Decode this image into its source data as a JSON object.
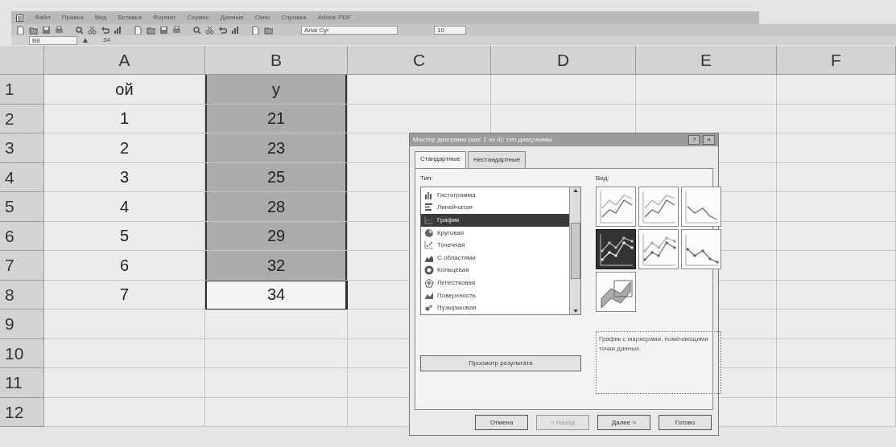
{
  "menu": [
    "Файл",
    "Правка",
    "Вид",
    "Вставка",
    "Формат",
    "Сервис",
    "Данные",
    "Окно",
    "Справка",
    "Adobe PDF"
  ],
  "toolbar": {
    "font": "Arial Cyr",
    "size": "10"
  },
  "formula_bar": {
    "cell": "B8",
    "value": "34"
  },
  "sheet": {
    "columns": [
      "A",
      "B",
      "C",
      "D",
      "E",
      "F"
    ],
    "rows": [
      {
        "number": "1",
        "cells": [
          {
            "text": "ой",
            "selected": false,
            "active": false
          },
          {
            "text": "у",
            "selected": true,
            "active": false
          }
        ]
      },
      {
        "number": "2",
        "cells": [
          {
            "text": "1",
            "selected": false,
            "active": false
          },
          {
            "text": "21",
            "selected": true,
            "active": false
          }
        ]
      },
      {
        "number": "3",
        "cells": [
          {
            "text": "2",
            "selected": false,
            "active": false
          },
          {
            "text": "23",
            "selected": true,
            "active": false
          }
        ]
      },
      {
        "number": "4",
        "cells": [
          {
            "text": "3",
            "selected": false,
            "active": false
          },
          {
            "text": "25",
            "selected": true,
            "active": false
          }
        ]
      },
      {
        "number": "5",
        "cells": [
          {
            "text": "4",
            "selected": false,
            "active": false
          },
          {
            "text": "28",
            "selected": true,
            "active": false
          }
        ]
      },
      {
        "number": "6",
        "cells": [
          {
            "text": "5",
            "selected": false,
            "active": false
          },
          {
            "text": "29",
            "selected": true,
            "active": false
          }
        ]
      },
      {
        "number": "7",
        "cells": [
          {
            "text": "6",
            "selected": false,
            "active": false
          },
          {
            "text": "32",
            "selected": true,
            "active": false
          }
        ]
      },
      {
        "number": "8",
        "cells": [
          {
            "text": "7",
            "selected": false,
            "active": false
          },
          {
            "text": "34",
            "selected": true,
            "active": true
          }
        ]
      },
      {
        "number": "9"
      },
      {
        "number": "10"
      },
      {
        "number": "11"
      },
      {
        "number": "12"
      }
    ]
  },
  "dialog": {
    "title": "Мастер диаграмм (шаг 1 из 4): тип диаграммы",
    "title_buttons": [
      "?",
      "×"
    ],
    "tabs": [
      {
        "label": "Стандартные",
        "selected": true
      },
      {
        "label": "Нестандартные",
        "selected": false
      }
    ],
    "type_label": "Тип:",
    "types": [
      {
        "label": "Гистограмма",
        "kind": "column",
        "selected": false
      },
      {
        "label": "Линейчатая",
        "kind": "bar",
        "selected": false
      },
      {
        "label": "График",
        "kind": "line",
        "selected": true
      },
      {
        "label": "Круговая",
        "kind": "pie",
        "selected": false
      },
      {
        "label": "Точечная",
        "kind": "scatter",
        "selected": false
      },
      {
        "label": "С областями",
        "kind": "area",
        "selected": false
      },
      {
        "label": "Кольцевая",
        "kind": "doughnut",
        "selected": false
      },
      {
        "label": "Лепестковая",
        "kind": "radar",
        "selected": false
      },
      {
        "label": "Поверхность",
        "kind": "surface",
        "selected": false
      },
      {
        "label": "Пузырьковая",
        "kind": "bubble",
        "selected": false
      }
    ],
    "view_label": "Вид:",
    "subtypes": [
      {
        "kind": "lines",
        "selected": false
      },
      {
        "kind": "stacked",
        "selected": false
      },
      {
        "kind": "single",
        "selected": false
      },
      {
        "kind": "markers",
        "selected": true
      },
      {
        "kind": "stacked-markers",
        "selected": false
      },
      {
        "kind": "single-markers",
        "selected": false
      },
      {
        "kind": "perspective",
        "selected": false
      }
    ],
    "description": "График с маркерами, помечающими точки данных.",
    "preview_button": "Просмотр результата",
    "buttons": [
      {
        "label": "Отмена",
        "disabled": false
      },
      {
        "label": "< Назад",
        "disabled": true
      },
      {
        "label": "Далее >",
        "disabled": false
      },
      {
        "label": "Готово",
        "disabled": false
      }
    ]
  }
}
